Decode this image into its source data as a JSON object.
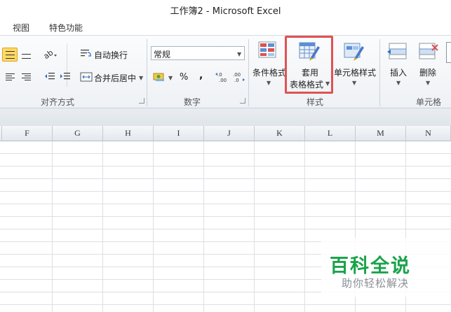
{
  "window": {
    "title": "工作簿2  -  Microsoft Excel"
  },
  "tabs": [
    {
      "label": "视图"
    },
    {
      "label": "特色功能"
    }
  ],
  "ribbon": {
    "alignment": {
      "group_label": "对齐方式",
      "wrap_text": "自动换行",
      "merge_center": "合并后居中"
    },
    "number": {
      "group_label": "数字",
      "format_value": "常规",
      "percent": "%",
      "comma": ",",
      "inc_decimal": "←.0\n.00",
      "dec_decimal": ".00\n→.0"
    },
    "styles": {
      "group_label": "样式",
      "conditional_format": "条件格式",
      "format_table_line1": "套用",
      "format_table_line2": "表格格式",
      "cell_styles": "单元格样式"
    },
    "cells": {
      "group_label": "单元格",
      "insert": "插入",
      "delete": "删除"
    }
  },
  "columns": [
    "F",
    "G",
    "H",
    "I",
    "J",
    "K",
    "L",
    "M",
    "N"
  ],
  "watermark": {
    "title": "百科全说",
    "subtitle": "助你轻松解决"
  },
  "colors": {
    "highlight": "#e05252",
    "watermark_green": "#1aa34a",
    "active_button": "#ffd966"
  }
}
